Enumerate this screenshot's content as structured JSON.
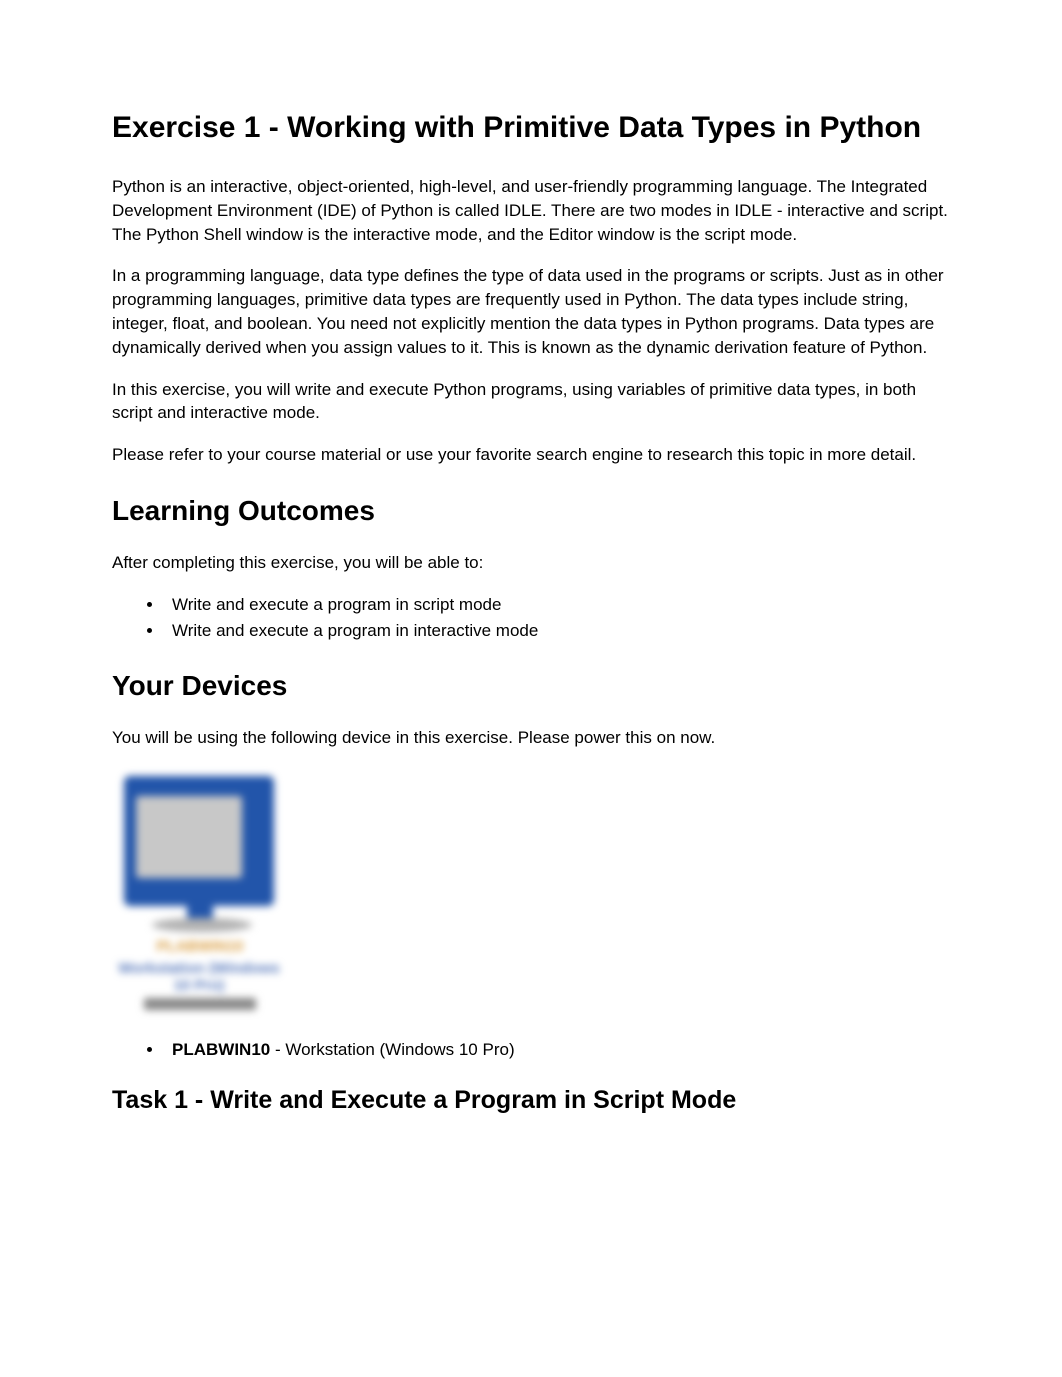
{
  "title": "Exercise 1 - Working with Primitive Data Types in Python",
  "intro_paragraphs": [
    "Python is an interactive, object-oriented, high-level, and user-friendly programming language. The Integrated Development Environment (IDE) of Python is called IDLE. There are two modes in IDLE - interactive and script. The Python Shell window is the interactive mode, and the Editor window is the script mode.",
    "In a programming language, data type defines the type of data used in the programs or scripts. Just as in other programming languages, primitive data types are frequently used in Python. The data types include string, integer, float, and boolean. You need not explicitly mention the data types in Python programs. Data types are dynamically derived when you assign values to it. This is known as the dynamic derivation feature of Python.",
    "In this exercise, you will write and execute Python programs, using variables of primitive data types, in both script and interactive mode.",
    "Please refer to your course material or use your favorite search engine to research this topic in more detail."
  ],
  "learning_outcomes": {
    "heading": "Learning Outcomes",
    "intro": "After completing this exercise, you will be able to:",
    "items": [
      "Write and execute a program in script mode",
      "Write and execute a program in interactive mode"
    ]
  },
  "your_devices": {
    "heading": "Your Devices",
    "intro": "You will be using the following device in this exercise. Please power this on now.",
    "device_name": "PLABWIN10",
    "device_description": " - Workstation (Windows 10 Pro)",
    "blurred_label_1": "PLABWIN10",
    "blurred_label_2": "Workstation (Windows 10 Pro)"
  },
  "task1": {
    "heading": "Task 1 - Write and Execute a Program in Script Mode"
  }
}
